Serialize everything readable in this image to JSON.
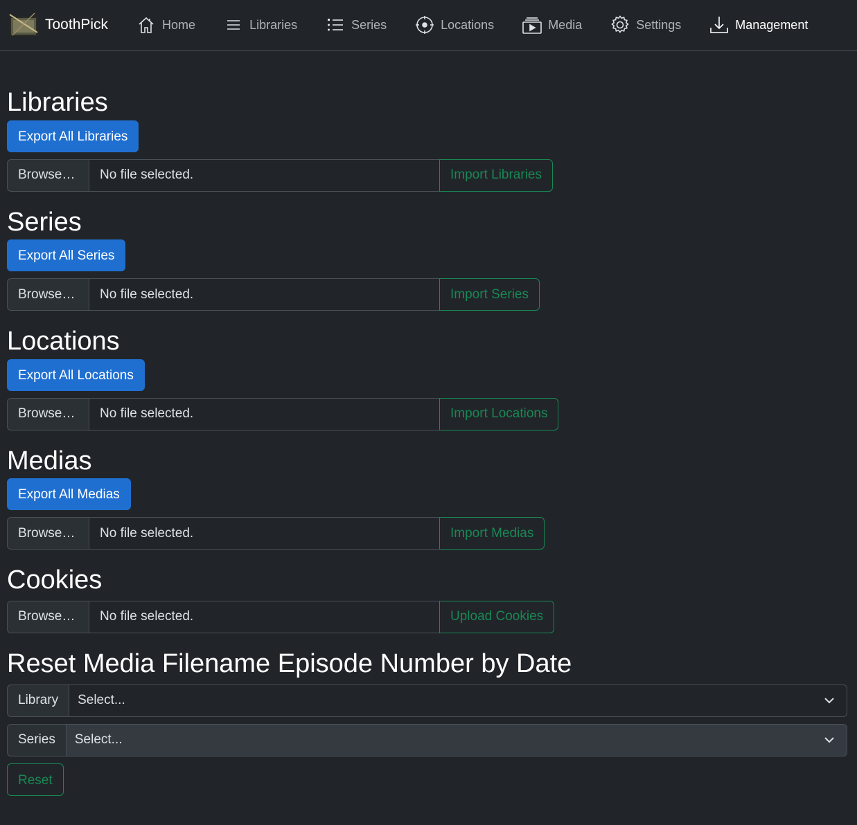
{
  "nav": {
    "brand": "ToothPick",
    "items": [
      {
        "label": "Home",
        "icon": "home-icon",
        "active": false
      },
      {
        "label": "Libraries",
        "icon": "list-icon",
        "active": false
      },
      {
        "label": "Series",
        "icon": "list-ul-icon",
        "active": false
      },
      {
        "label": "Locations",
        "icon": "target-icon",
        "active": false
      },
      {
        "label": "Media",
        "icon": "media-icon",
        "active": false
      },
      {
        "label": "Settings",
        "icon": "gear-icon",
        "active": false
      },
      {
        "label": "Management",
        "icon": "download-icon",
        "active": true
      }
    ]
  },
  "sections": {
    "libraries": {
      "title": "Libraries",
      "export_label": "Export All Libraries",
      "browse_label": "Browse…",
      "file_status": "No file selected.",
      "import_label": "Import Libraries"
    },
    "series": {
      "title": "Series",
      "export_label": "Export All Series",
      "browse_label": "Browse…",
      "file_status": "No file selected.",
      "import_label": "Import Series"
    },
    "locations": {
      "title": "Locations",
      "export_label": "Export All Locations",
      "browse_label": "Browse…",
      "file_status": "No file selected.",
      "import_label": "Import Locations"
    },
    "medias": {
      "title": "Medias",
      "export_label": "Export All Medias",
      "browse_label": "Browse…",
      "file_status": "No file selected.",
      "import_label": "Import Medias"
    },
    "cookies": {
      "title": "Cookies",
      "browse_label": "Browse…",
      "file_status": "No file selected.",
      "upload_label": "Upload Cookies"
    }
  },
  "reset": {
    "title": "Reset Media Filename Episode Number by Date",
    "library_label": "Library",
    "library_value": "Select...",
    "series_label": "Series",
    "series_value": "Select...",
    "reset_label": "Reset"
  },
  "colors": {
    "background": "#212529",
    "primary": "#1f6fd1",
    "success": "#198754",
    "border": "#495057"
  }
}
